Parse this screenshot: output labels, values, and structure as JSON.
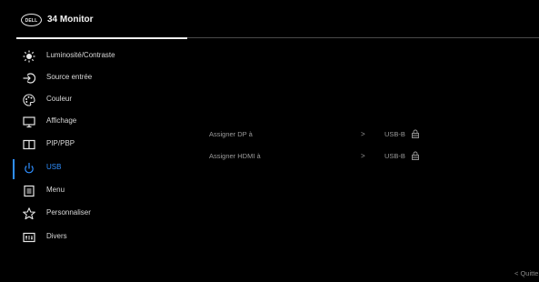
{
  "header": {
    "logo_text": "DELL",
    "title": "34 Monitor"
  },
  "menu": {
    "items": [
      {
        "label": "Luminosité/Contraste",
        "icon": "brightness-icon"
      },
      {
        "label": "Source entrée",
        "icon": "input-source-icon"
      },
      {
        "label": "Couleur",
        "icon": "color-palette-icon"
      },
      {
        "label": "Affichage",
        "icon": "display-icon"
      },
      {
        "label": "PIP/PBP",
        "icon": "pip-pbp-icon"
      },
      {
        "label": "USB",
        "icon": "usb-icon",
        "selected": true
      },
      {
        "label": "Menu",
        "icon": "menu-icon"
      },
      {
        "label": "Personnaliser",
        "icon": "star-icon"
      },
      {
        "label": "Divers",
        "icon": "misc-icon"
      }
    ]
  },
  "settings": {
    "rows": [
      {
        "label": "Assigner DP à",
        "arrow": ">",
        "value": "USB-B",
        "icon": "lock-icon"
      },
      {
        "label": "Assigner HDMI à",
        "arrow": ">",
        "value": "USB-B",
        "icon": "lock-icon"
      }
    ]
  },
  "footer": {
    "quit_label": "< Quitte"
  },
  "colors": {
    "accent": "#2F8FFF",
    "background": "#000000",
    "text": "#D8D8D8",
    "muted": "#9A9A9A"
  }
}
